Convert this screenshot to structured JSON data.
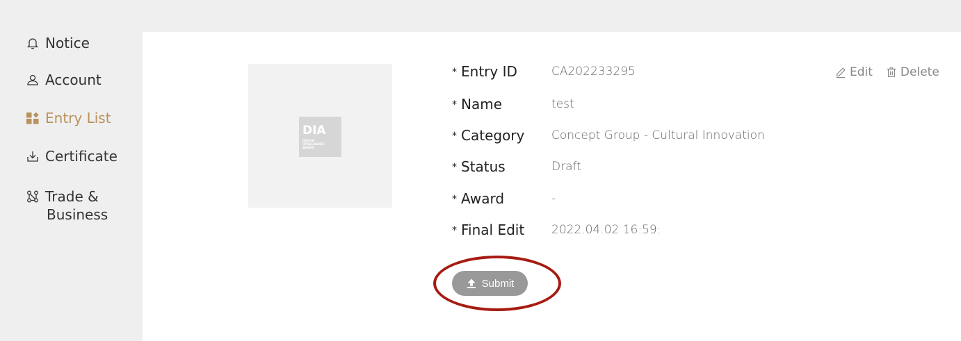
{
  "sidebar": {
    "items": [
      {
        "label": "Notice",
        "icon": "bell-icon"
      },
      {
        "label": "Account",
        "icon": "user-icon"
      },
      {
        "label": "Entry List",
        "icon": "grid-icon",
        "active": true
      },
      {
        "label": "Certificate",
        "icon": "download-icon"
      },
      {
        "label": "Trade &",
        "label2": "Business",
        "icon": "network-icon"
      }
    ]
  },
  "entry": {
    "logo_mark": "DIA",
    "logo_sub": [
      "DESIGN",
      "INTELLIGENCE",
      "AWARD"
    ],
    "fields": [
      {
        "label": "Entry ID",
        "value": "CA202233295"
      },
      {
        "label": "Name",
        "value": "test"
      },
      {
        "label": "Category",
        "value": "Concept Group - Cultural Innovation"
      },
      {
        "label": "Status",
        "value": "Draft"
      },
      {
        "label": "Award",
        "value": "-"
      },
      {
        "label": "Final Edit",
        "value": "2022.04.02 16:59:"
      }
    ],
    "star": "*",
    "edit_label": "Edit",
    "delete_label": "Delete",
    "submit_label": "Submit"
  },
  "colors": {
    "accent": "#b8925a",
    "highlight_ring": "#a61b12",
    "submit_bg": "#999999"
  }
}
